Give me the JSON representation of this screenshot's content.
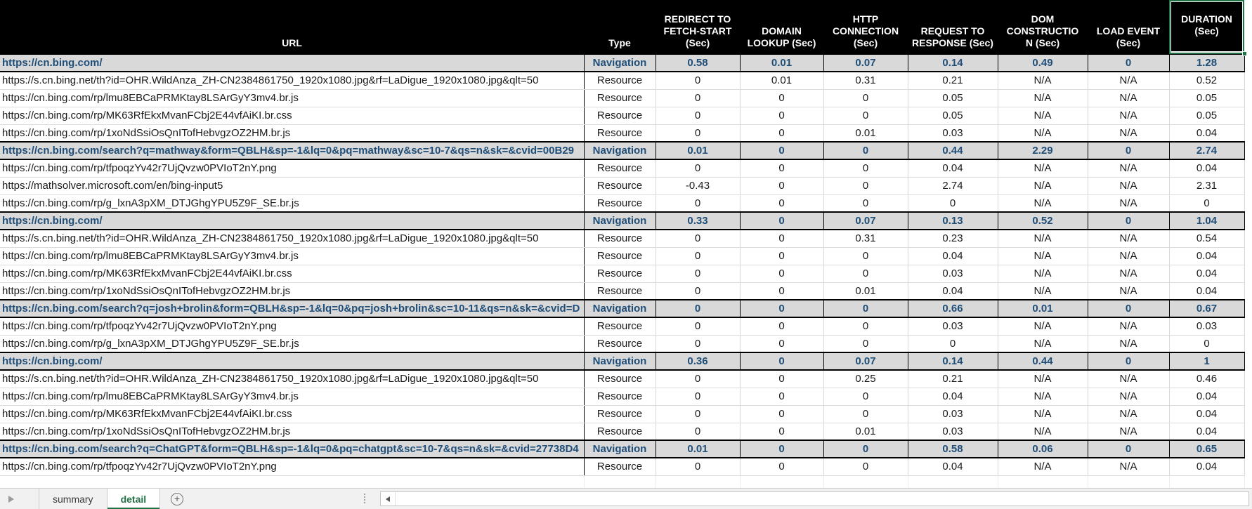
{
  "header": {
    "columns": [
      "URL",
      "Type",
      "REDIRECT TO\nFETCH-START\n(Sec)",
      "DOMAIN\nLOOKUP (Sec)",
      "HTTP\nCONNECTION\n(Sec)",
      "REQUEST TO\nRESPONSE (Sec)",
      "DOM\nCONSTRUCTIO\nN (Sec)",
      "LOAD EVENT\n(Sec)",
      "DURATION\n(Sec)"
    ]
  },
  "selection": {
    "selected_header": "DURATION (Sec)"
  },
  "rows": [
    {
      "url": "https://cn.bing.com/",
      "type": "Navigation",
      "redirect_to_fetch_start": "0.58",
      "domain_lookup": "0.01",
      "http_connection": "0.07",
      "request_to_response": "0.14",
      "dom_construction": "0.49",
      "load_event": "0",
      "duration": "1.28"
    },
    {
      "url": "https://s.cn.bing.net/th?id=OHR.WildAnza_ZH-CN2384861750_1920x1080.jpg&rf=LaDigue_1920x1080.jpg&qlt=50",
      "type": "Resource",
      "redirect_to_fetch_start": "0",
      "domain_lookup": "0.01",
      "http_connection": "0.31",
      "request_to_response": "0.21",
      "dom_construction": "N/A",
      "load_event": "N/A",
      "duration": "0.52"
    },
    {
      "url": "https://cn.bing.com/rp/lmu8EBCaPRMKtay8LSArGyY3mv4.br.js",
      "type": "Resource",
      "redirect_to_fetch_start": "0",
      "domain_lookup": "0",
      "http_connection": "0",
      "request_to_response": "0.05",
      "dom_construction": "N/A",
      "load_event": "N/A",
      "duration": "0.05"
    },
    {
      "url": "https://cn.bing.com/rp/MK63RfEkxMvanFCbj2E44vfAiKI.br.css",
      "type": "Resource",
      "redirect_to_fetch_start": "0",
      "domain_lookup": "0",
      "http_connection": "0",
      "request_to_response": "0.05",
      "dom_construction": "N/A",
      "load_event": "N/A",
      "duration": "0.05"
    },
    {
      "url": "https://cn.bing.com/rp/1xoNdSsiOsQnITofHebvgzOZ2HM.br.js",
      "type": "Resource",
      "redirect_to_fetch_start": "0",
      "domain_lookup": "0",
      "http_connection": "0.01",
      "request_to_response": "0.03",
      "dom_construction": "N/A",
      "load_event": "N/A",
      "duration": "0.04"
    },
    {
      "url": "https://cn.bing.com/search?q=mathway&form=QBLH&sp=-1&lq=0&pq=mathway&sc=10-7&qs=n&sk=&cvid=00B29",
      "type": "Navigation",
      "redirect_to_fetch_start": "0.01",
      "domain_lookup": "0",
      "http_connection": "0",
      "request_to_response": "0.44",
      "dom_construction": "2.29",
      "load_event": "0",
      "duration": "2.74"
    },
    {
      "url": "https://cn.bing.com/rp/tfpoqzYv42r7UjQvzw0PVIoT2nY.png",
      "type": "Resource",
      "redirect_to_fetch_start": "0",
      "domain_lookup": "0",
      "http_connection": "0",
      "request_to_response": "0.04",
      "dom_construction": "N/A",
      "load_event": "N/A",
      "duration": "0.04"
    },
    {
      "url": "https://mathsolver.microsoft.com/en/bing-input5",
      "type": "Resource",
      "redirect_to_fetch_start": "-0.43",
      "domain_lookup": "0",
      "http_connection": "0",
      "request_to_response": "2.74",
      "dom_construction": "N/A",
      "load_event": "N/A",
      "duration": "2.31"
    },
    {
      "url": "https://cn.bing.com/rp/g_lxnA3pXM_DTJGhgYPU5Z9F_SE.br.js",
      "type": "Resource",
      "redirect_to_fetch_start": "0",
      "domain_lookup": "0",
      "http_connection": "0",
      "request_to_response": "0",
      "dom_construction": "N/A",
      "load_event": "N/A",
      "duration": "0"
    },
    {
      "url": "https://cn.bing.com/",
      "type": "Navigation",
      "redirect_to_fetch_start": "0.33",
      "domain_lookup": "0",
      "http_connection": "0.07",
      "request_to_response": "0.13",
      "dom_construction": "0.52",
      "load_event": "0",
      "duration": "1.04"
    },
    {
      "url": "https://s.cn.bing.net/th?id=OHR.WildAnza_ZH-CN2384861750_1920x1080.jpg&rf=LaDigue_1920x1080.jpg&qlt=50",
      "type": "Resource",
      "redirect_to_fetch_start": "0",
      "domain_lookup": "0",
      "http_connection": "0.31",
      "request_to_response": "0.23",
      "dom_construction": "N/A",
      "load_event": "N/A",
      "duration": "0.54"
    },
    {
      "url": "https://cn.bing.com/rp/lmu8EBCaPRMKtay8LSArGyY3mv4.br.js",
      "type": "Resource",
      "redirect_to_fetch_start": "0",
      "domain_lookup": "0",
      "http_connection": "0",
      "request_to_response": "0.04",
      "dom_construction": "N/A",
      "load_event": "N/A",
      "duration": "0.04"
    },
    {
      "url": "https://cn.bing.com/rp/MK63RfEkxMvanFCbj2E44vfAiKI.br.css",
      "type": "Resource",
      "redirect_to_fetch_start": "0",
      "domain_lookup": "0",
      "http_connection": "0",
      "request_to_response": "0.03",
      "dom_construction": "N/A",
      "load_event": "N/A",
      "duration": "0.04"
    },
    {
      "url": "https://cn.bing.com/rp/1xoNdSsiOsQnITofHebvgzOZ2HM.br.js",
      "type": "Resource",
      "redirect_to_fetch_start": "0",
      "domain_lookup": "0",
      "http_connection": "0.01",
      "request_to_response": "0.04",
      "dom_construction": "N/A",
      "load_event": "N/A",
      "duration": "0.04"
    },
    {
      "url": "https://cn.bing.com/search?q=josh+brolin&form=QBLH&sp=-1&lq=0&pq=josh+brolin&sc=10-11&qs=n&sk=&cvid=D",
      "type": "Navigation",
      "redirect_to_fetch_start": "0",
      "domain_lookup": "0",
      "http_connection": "0",
      "request_to_response": "0.66",
      "dom_construction": "0.01",
      "load_event": "0",
      "duration": "0.67"
    },
    {
      "url": "https://cn.bing.com/rp/tfpoqzYv42r7UjQvzw0PVIoT2nY.png",
      "type": "Resource",
      "redirect_to_fetch_start": "0",
      "domain_lookup": "0",
      "http_connection": "0",
      "request_to_response": "0.03",
      "dom_construction": "N/A",
      "load_event": "N/A",
      "duration": "0.03"
    },
    {
      "url": "https://cn.bing.com/rp/g_lxnA3pXM_DTJGhgYPU5Z9F_SE.br.js",
      "type": "Resource",
      "redirect_to_fetch_start": "0",
      "domain_lookup": "0",
      "http_connection": "0",
      "request_to_response": "0",
      "dom_construction": "N/A",
      "load_event": "N/A",
      "duration": "0"
    },
    {
      "url": "https://cn.bing.com/",
      "type": "Navigation",
      "redirect_to_fetch_start": "0.36",
      "domain_lookup": "0",
      "http_connection": "0.07",
      "request_to_response": "0.14",
      "dom_construction": "0.44",
      "load_event": "0",
      "duration": "1"
    },
    {
      "url": "https://s.cn.bing.net/th?id=OHR.WildAnza_ZH-CN2384861750_1920x1080.jpg&rf=LaDigue_1920x1080.jpg&qlt=50",
      "type": "Resource",
      "redirect_to_fetch_start": "0",
      "domain_lookup": "0",
      "http_connection": "0.25",
      "request_to_response": "0.21",
      "dom_construction": "N/A",
      "load_event": "N/A",
      "duration": "0.46"
    },
    {
      "url": "https://cn.bing.com/rp/lmu8EBCaPRMKtay8LSArGyY3mv4.br.js",
      "type": "Resource",
      "redirect_to_fetch_start": "0",
      "domain_lookup": "0",
      "http_connection": "0",
      "request_to_response": "0.04",
      "dom_construction": "N/A",
      "load_event": "N/A",
      "duration": "0.04"
    },
    {
      "url": "https://cn.bing.com/rp/MK63RfEkxMvanFCbj2E44vfAiKI.br.css",
      "type": "Resource",
      "redirect_to_fetch_start": "0",
      "domain_lookup": "0",
      "http_connection": "0",
      "request_to_response": "0.03",
      "dom_construction": "N/A",
      "load_event": "N/A",
      "duration": "0.04"
    },
    {
      "url": "https://cn.bing.com/rp/1xoNdSsiOsQnITofHebvgzOZ2HM.br.js",
      "type": "Resource",
      "redirect_to_fetch_start": "0",
      "domain_lookup": "0",
      "http_connection": "0.01",
      "request_to_response": "0.03",
      "dom_construction": "N/A",
      "load_event": "N/A",
      "duration": "0.04"
    },
    {
      "url": "https://cn.bing.com/search?q=ChatGPT&form=QBLH&sp=-1&lq=0&pq=chatgpt&sc=10-7&qs=n&sk=&cvid=27738D4",
      "type": "Navigation",
      "redirect_to_fetch_start": "0.01",
      "domain_lookup": "0",
      "http_connection": "0",
      "request_to_response": "0.58",
      "dom_construction": "0.06",
      "load_event": "0",
      "duration": "0.65"
    },
    {
      "url": "https://cn.bing.com/rp/tfpoqzYv42r7UjQvzw0PVIoT2nY.png",
      "type": "Resource",
      "redirect_to_fetch_start": "0",
      "domain_lookup": "0",
      "http_connection": "0",
      "request_to_response": "0.04",
      "dom_construction": "N/A",
      "load_event": "N/A",
      "duration": "0.04"
    }
  ],
  "footer": {
    "tabs": [
      {
        "label": "summary",
        "active": false
      },
      {
        "label": "detail",
        "active": true
      }
    ],
    "add_sheet_label": "+"
  },
  "colors": {
    "header_bg": "#000000",
    "header_text": "#FFFFFF",
    "navigation_row_bg": "#D9D9D9",
    "navigation_text": "#1F4E79",
    "selection_green": "#217346",
    "active_tab_text": "#217346"
  }
}
